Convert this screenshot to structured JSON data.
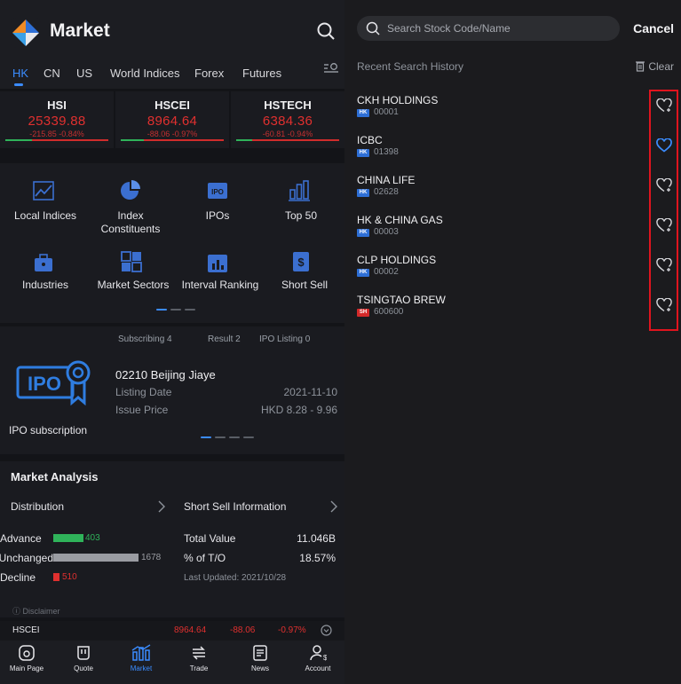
{
  "left": {
    "header": {
      "title": "Market",
      "search_icon": "search-icon",
      "logo_icon": "app-logo-icon"
    },
    "tabs": [
      "HK",
      "CN",
      "US",
      "World Indices",
      "Forex",
      "Futures"
    ],
    "active_tab": "HK",
    "indices": [
      {
        "name": "HSI",
        "value": "25339.88",
        "change": "-215.85 -0.84%"
      },
      {
        "name": "HSCEI",
        "value": "8964.64",
        "change": "-88.06 -0.97%"
      },
      {
        "name": "HSTECH",
        "value": "6384.36",
        "change": "-60.81 -0.94%"
      }
    ],
    "grid": [
      {
        "label": "Local Indices",
        "icon": "chart-trend-icon"
      },
      {
        "label": "Index Constituents",
        "icon": "pie-chart-icon"
      },
      {
        "label": "IPOs",
        "icon": "ipo-icon"
      },
      {
        "label": "Top 50",
        "icon": "bar-chart-icon"
      },
      {
        "label": "Industries",
        "icon": "briefcase-icon"
      },
      {
        "label": "Market Sectors",
        "icon": "grid-icon"
      },
      {
        "label": "Interval Ranking",
        "icon": "ranking-icon"
      },
      {
        "label": "Short Sell",
        "icon": "dollar-icon"
      }
    ],
    "ipo": {
      "label": "IPO subscription",
      "tabs": [
        "Subscribing 4",
        "Result 2",
        "IPO Listing 0"
      ],
      "name": "02210 Beijing Jiaye",
      "listing_date_label": "Listing Date",
      "listing_date": "2021-11-10",
      "issue_price_label": "Issue Price",
      "issue_price": "HKD 8.28 - 9.96"
    },
    "analysis": {
      "title": "Market Analysis",
      "distribution": "Distribution",
      "advance": {
        "label": "Advance",
        "value": "403"
      },
      "unchanged": {
        "label": "Unchanged",
        "value": "1678"
      },
      "decline": {
        "label": "Decline",
        "value": "510"
      },
      "short_sell_title": "Short Sell Information",
      "total_value_label": "Total Value",
      "total_value": "11.046B",
      "pct_label": "% of T/O",
      "pct": "18.57%",
      "updated": "Last Updated: 2021/10/28",
      "disclaimer": "Disclaimer"
    },
    "ticker": {
      "name": "HSCEI",
      "value": "8964.64",
      "change": "-88.06",
      "pct": "-0.97%"
    },
    "bottom_nav": [
      {
        "label": "Main Page",
        "icon": "home-icon"
      },
      {
        "label": "Quote",
        "icon": "quote-icon"
      },
      {
        "label": "Market",
        "icon": "market-icon"
      },
      {
        "label": "Trade",
        "icon": "trade-icon"
      },
      {
        "label": "News",
        "icon": "news-icon"
      },
      {
        "label": "Account",
        "icon": "account-icon"
      }
    ],
    "active_nav": "Market"
  },
  "right": {
    "search_placeholder": "Search Stock Code/Name",
    "cancel": "Cancel",
    "recent_title": "Recent Search History",
    "clear": "Clear",
    "items": [
      {
        "name": "CKH HOLDINGS",
        "market": "HK",
        "code": "00001",
        "favorited": false
      },
      {
        "name": "ICBC",
        "market": "HK",
        "code": "01398",
        "favorited": true
      },
      {
        "name": "CHINA LIFE",
        "market": "HK",
        "code": "02628",
        "favorited": false
      },
      {
        "name": "HK & CHINA GAS",
        "market": "HK",
        "code": "00003",
        "favorited": false
      },
      {
        "name": "CLP HOLDINGS",
        "market": "HK",
        "code": "00002",
        "favorited": false
      },
      {
        "name": "TSINGTAO BREW",
        "market": "SH",
        "code": "600600",
        "favorited": false
      }
    ]
  },
  "colors": {
    "accent": "#3b8cff",
    "down": "#e0302f",
    "up": "#2fb35a",
    "highlight": "#e0141e",
    "sh_badge": "#d42a2a"
  }
}
